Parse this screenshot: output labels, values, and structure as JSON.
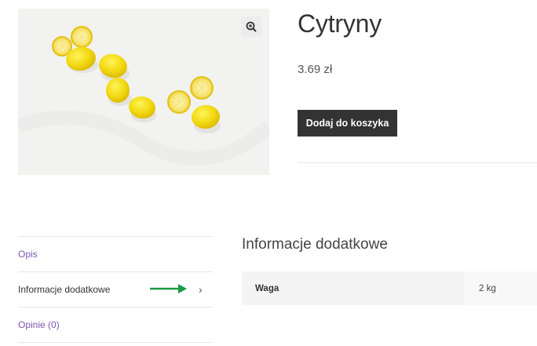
{
  "product": {
    "title": "Cytryny",
    "price": "3.69 zł",
    "add_to_cart_label": "Dodaj do koszyka",
    "image_icon": "lemons-photo",
    "zoom_icon": "zoom-in-icon"
  },
  "tabs": [
    {
      "label": "Opis"
    },
    {
      "label": "Informacje dodatkowe"
    },
    {
      "label": "Opinie (0)"
    }
  ],
  "panel": {
    "title": "Informacje dodatkowe",
    "attributes": [
      {
        "label": "Waga",
        "value": "2 kg"
      }
    ]
  },
  "colors": {
    "accent": "#7f54b3",
    "button": "#333333",
    "arrow": "#1a9a45"
  }
}
